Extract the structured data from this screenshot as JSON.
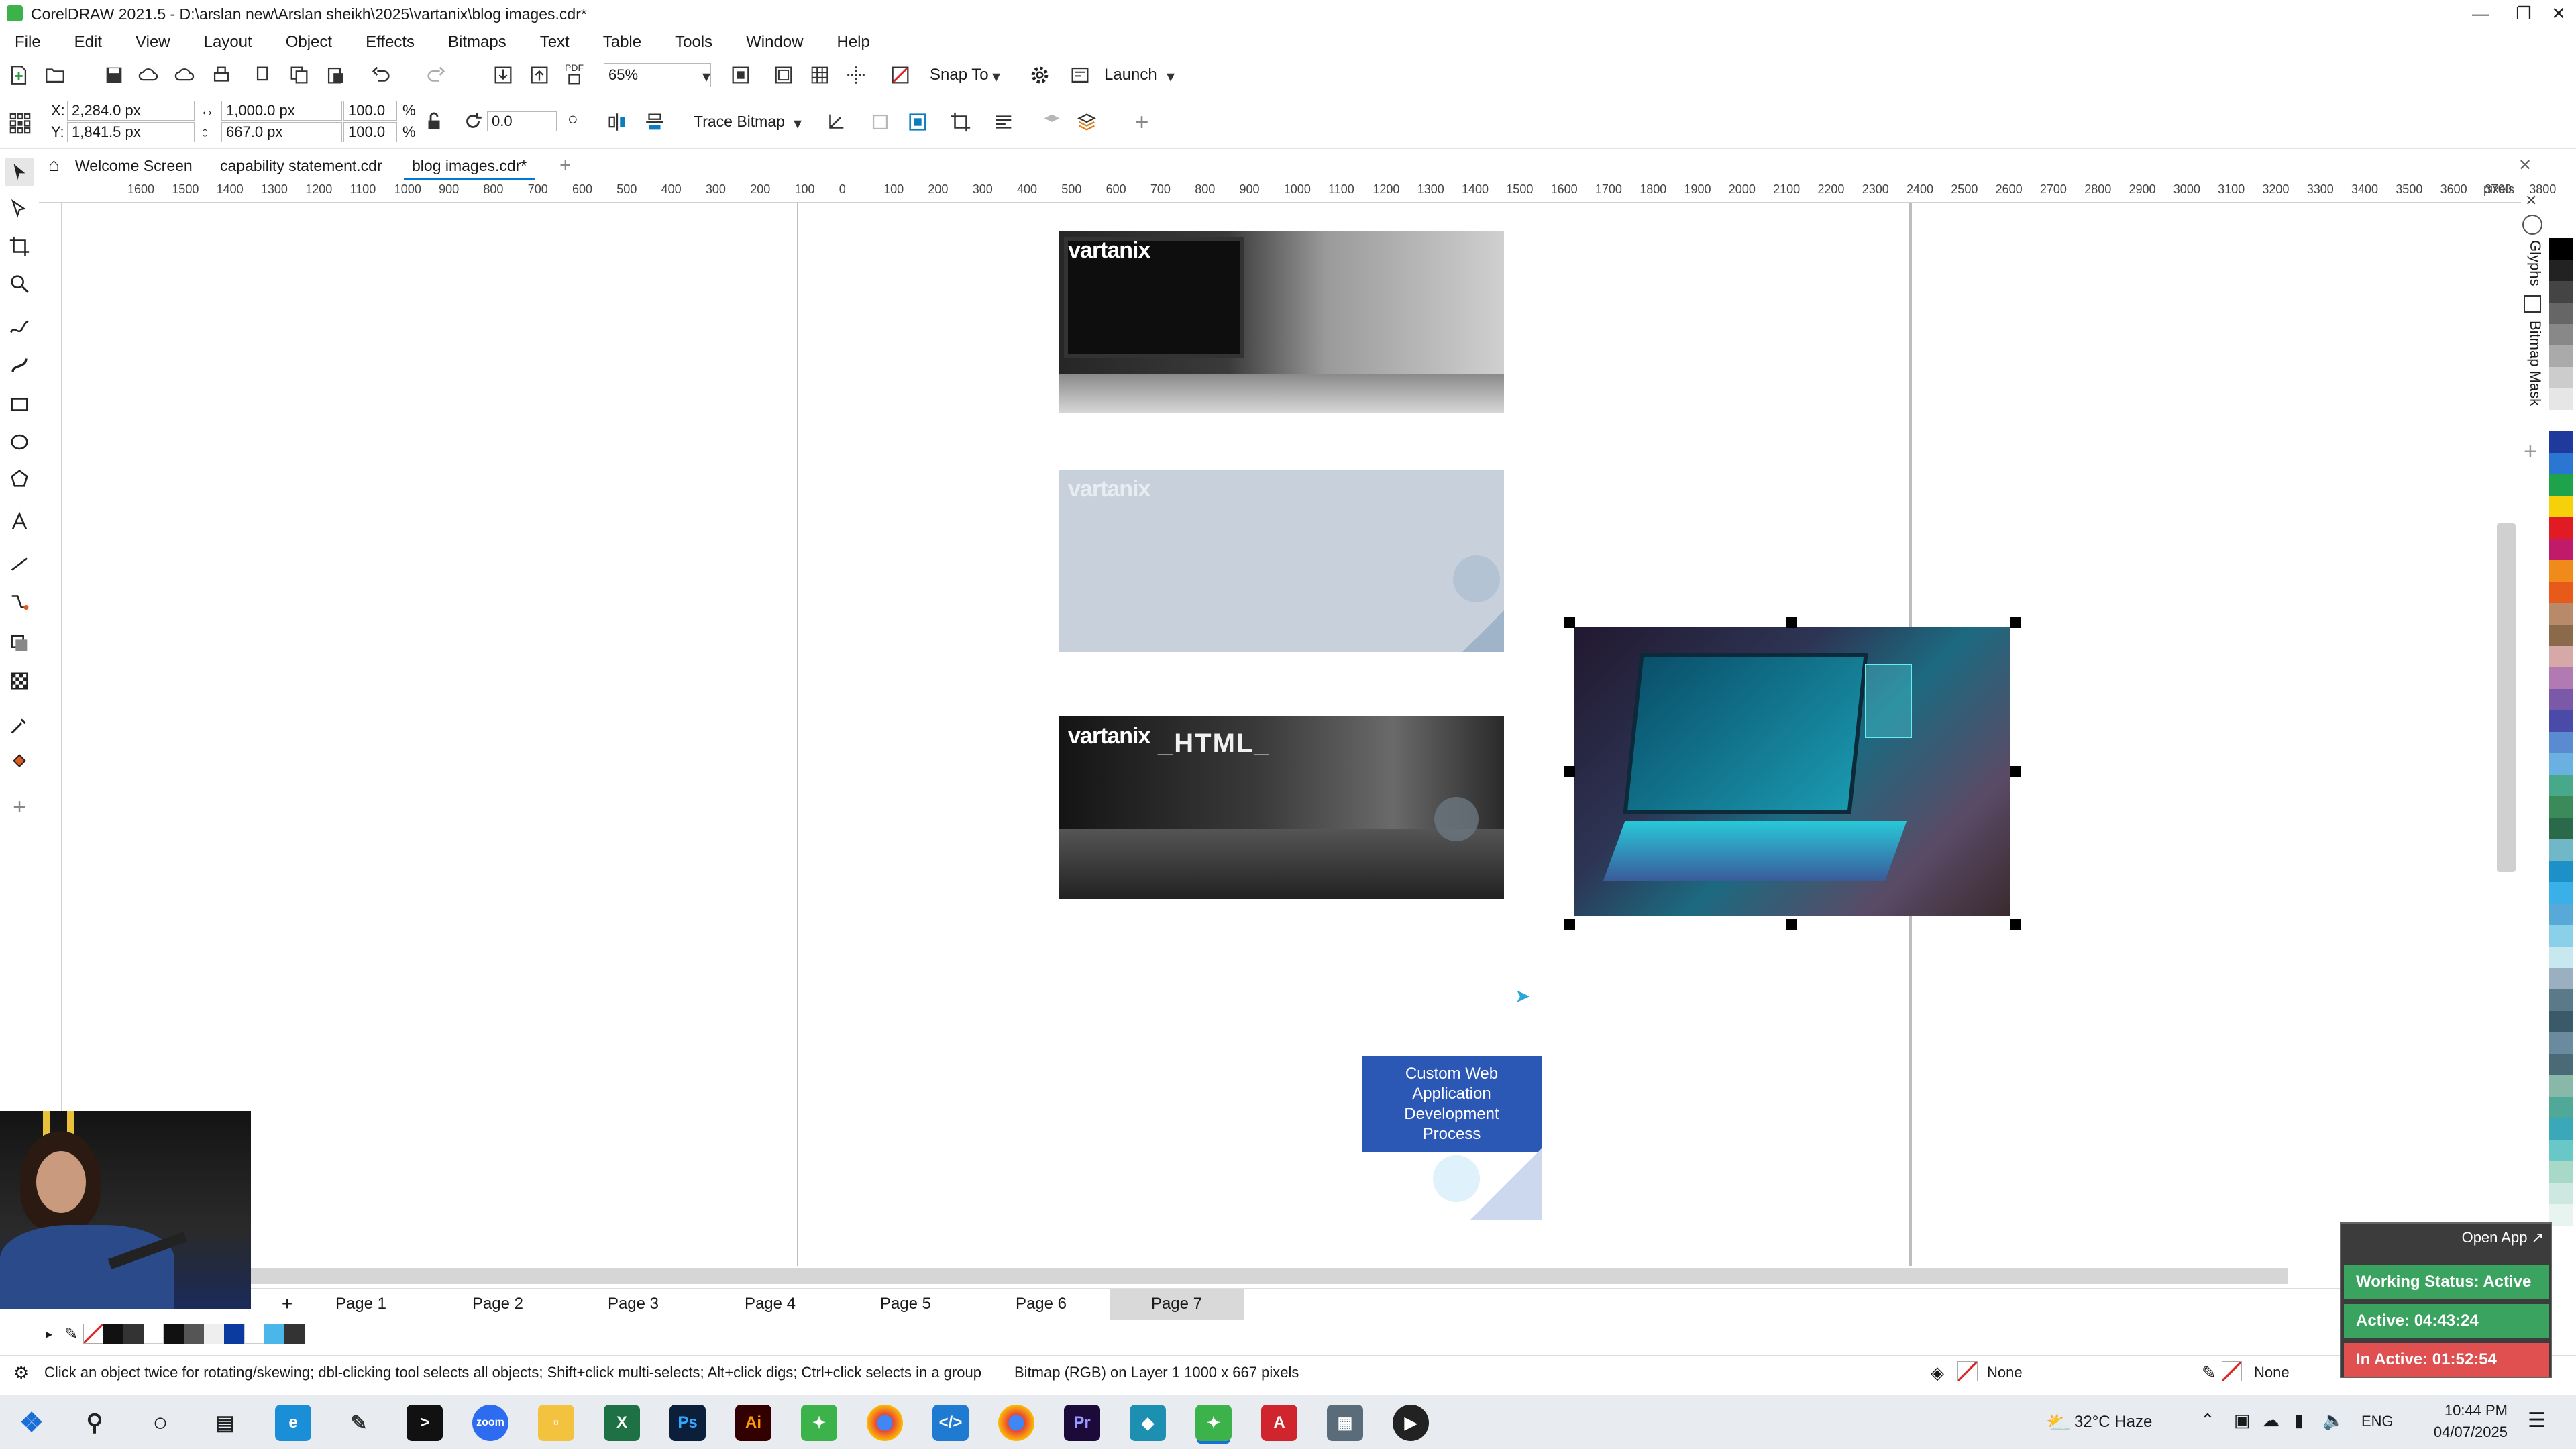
{
  "window": {
    "title": "CorelDRAW 2021.5 - D:\\arslan new\\Arslan sheikh\\2025\\vartanix\\blog images.cdr*"
  },
  "menu": [
    "File",
    "Edit",
    "View",
    "Layout",
    "Object",
    "Effects",
    "Bitmaps",
    "Text",
    "Table",
    "Tools",
    "Window",
    "Help"
  ],
  "toolbar": {
    "zoom": "65%",
    "snap_label": "Snap To",
    "launch_label": "Launch",
    "pdf_label": "PDF"
  },
  "propbar": {
    "x": "2,284.0 px",
    "y": "1,841.5 px",
    "width": "1,000.0 px",
    "height": "667.0 px",
    "scale_w": "100.0",
    "scale_h": "100.0",
    "percent": "%",
    "rotation": "0.0",
    "trace_label": "Trace Bitmap",
    "x_label": "X:",
    "y_label": "Y:"
  },
  "tabs": [
    {
      "label": "Welcome Screen"
    },
    {
      "label": "capability statement.cdr"
    },
    {
      "label": "blog images.cdr*"
    }
  ],
  "ruler": {
    "ticks": [
      "1600",
      "1500",
      "1400",
      "1300",
      "1200",
      "1100",
      "1000",
      "900",
      "800",
      "700",
      "600",
      "500",
      "400",
      "300",
      "200",
      "100",
      "0",
      "100",
      "200",
      "300",
      "400",
      "500",
      "600",
      "700",
      "800",
      "900",
      "1000",
      "1100",
      "1200",
      "1300",
      "1400",
      "1500",
      "1600",
      "1700",
      "1800",
      "1900",
      "2000",
      "2100",
      "2200",
      "2300",
      "2400",
      "2500",
      "2600",
      "2700",
      "2800",
      "2900",
      "3000",
      "3100",
      "3200",
      "3300",
      "3400",
      "3500",
      "3600",
      "3700",
      "3800"
    ],
    "unit": "pixels"
  },
  "canvas": {
    "logo_text": "vartanix",
    "html_text": "_HTML_",
    "box_text": "Custom Web Application Development Process"
  },
  "pages": [
    "Page 1",
    "Page 2",
    "Page 3",
    "Page 4",
    "Page 5",
    "Page 6",
    "Page 7"
  ],
  "status": {
    "hint": "Click an object twice for rotating/skewing; dbl-clicking tool selects all objects; Shift+click multi-selects; Alt+click digs; Ctrl+click selects in a group",
    "object_info": "Bitmap (RGB) on Layer 1 1000 x 667 pixels",
    "fill": "None",
    "outline": "None"
  },
  "docker": {
    "glyphs": "Glyphs",
    "bitmap_mask": "Bitmap Mask"
  },
  "tracker": {
    "open_app": "Open App ↗",
    "working_status": "Working Status: Active",
    "active": "Active: 04:43:24",
    "inactive": "In Active: 01:52:54"
  },
  "taskbar": {
    "weather": "32°C Haze",
    "lang": "ENG",
    "time": "10:44 PM",
    "date": "04/07/2025",
    "apps": [
      "Ps",
      "Ai",
      "Pr"
    ]
  },
  "colors": {
    "accent": "#0078d4",
    "box_blue": "#2b57b5",
    "tracker_green": "#3aa35f",
    "tracker_red": "#e05050",
    "corel_green": "#3cb34a"
  }
}
